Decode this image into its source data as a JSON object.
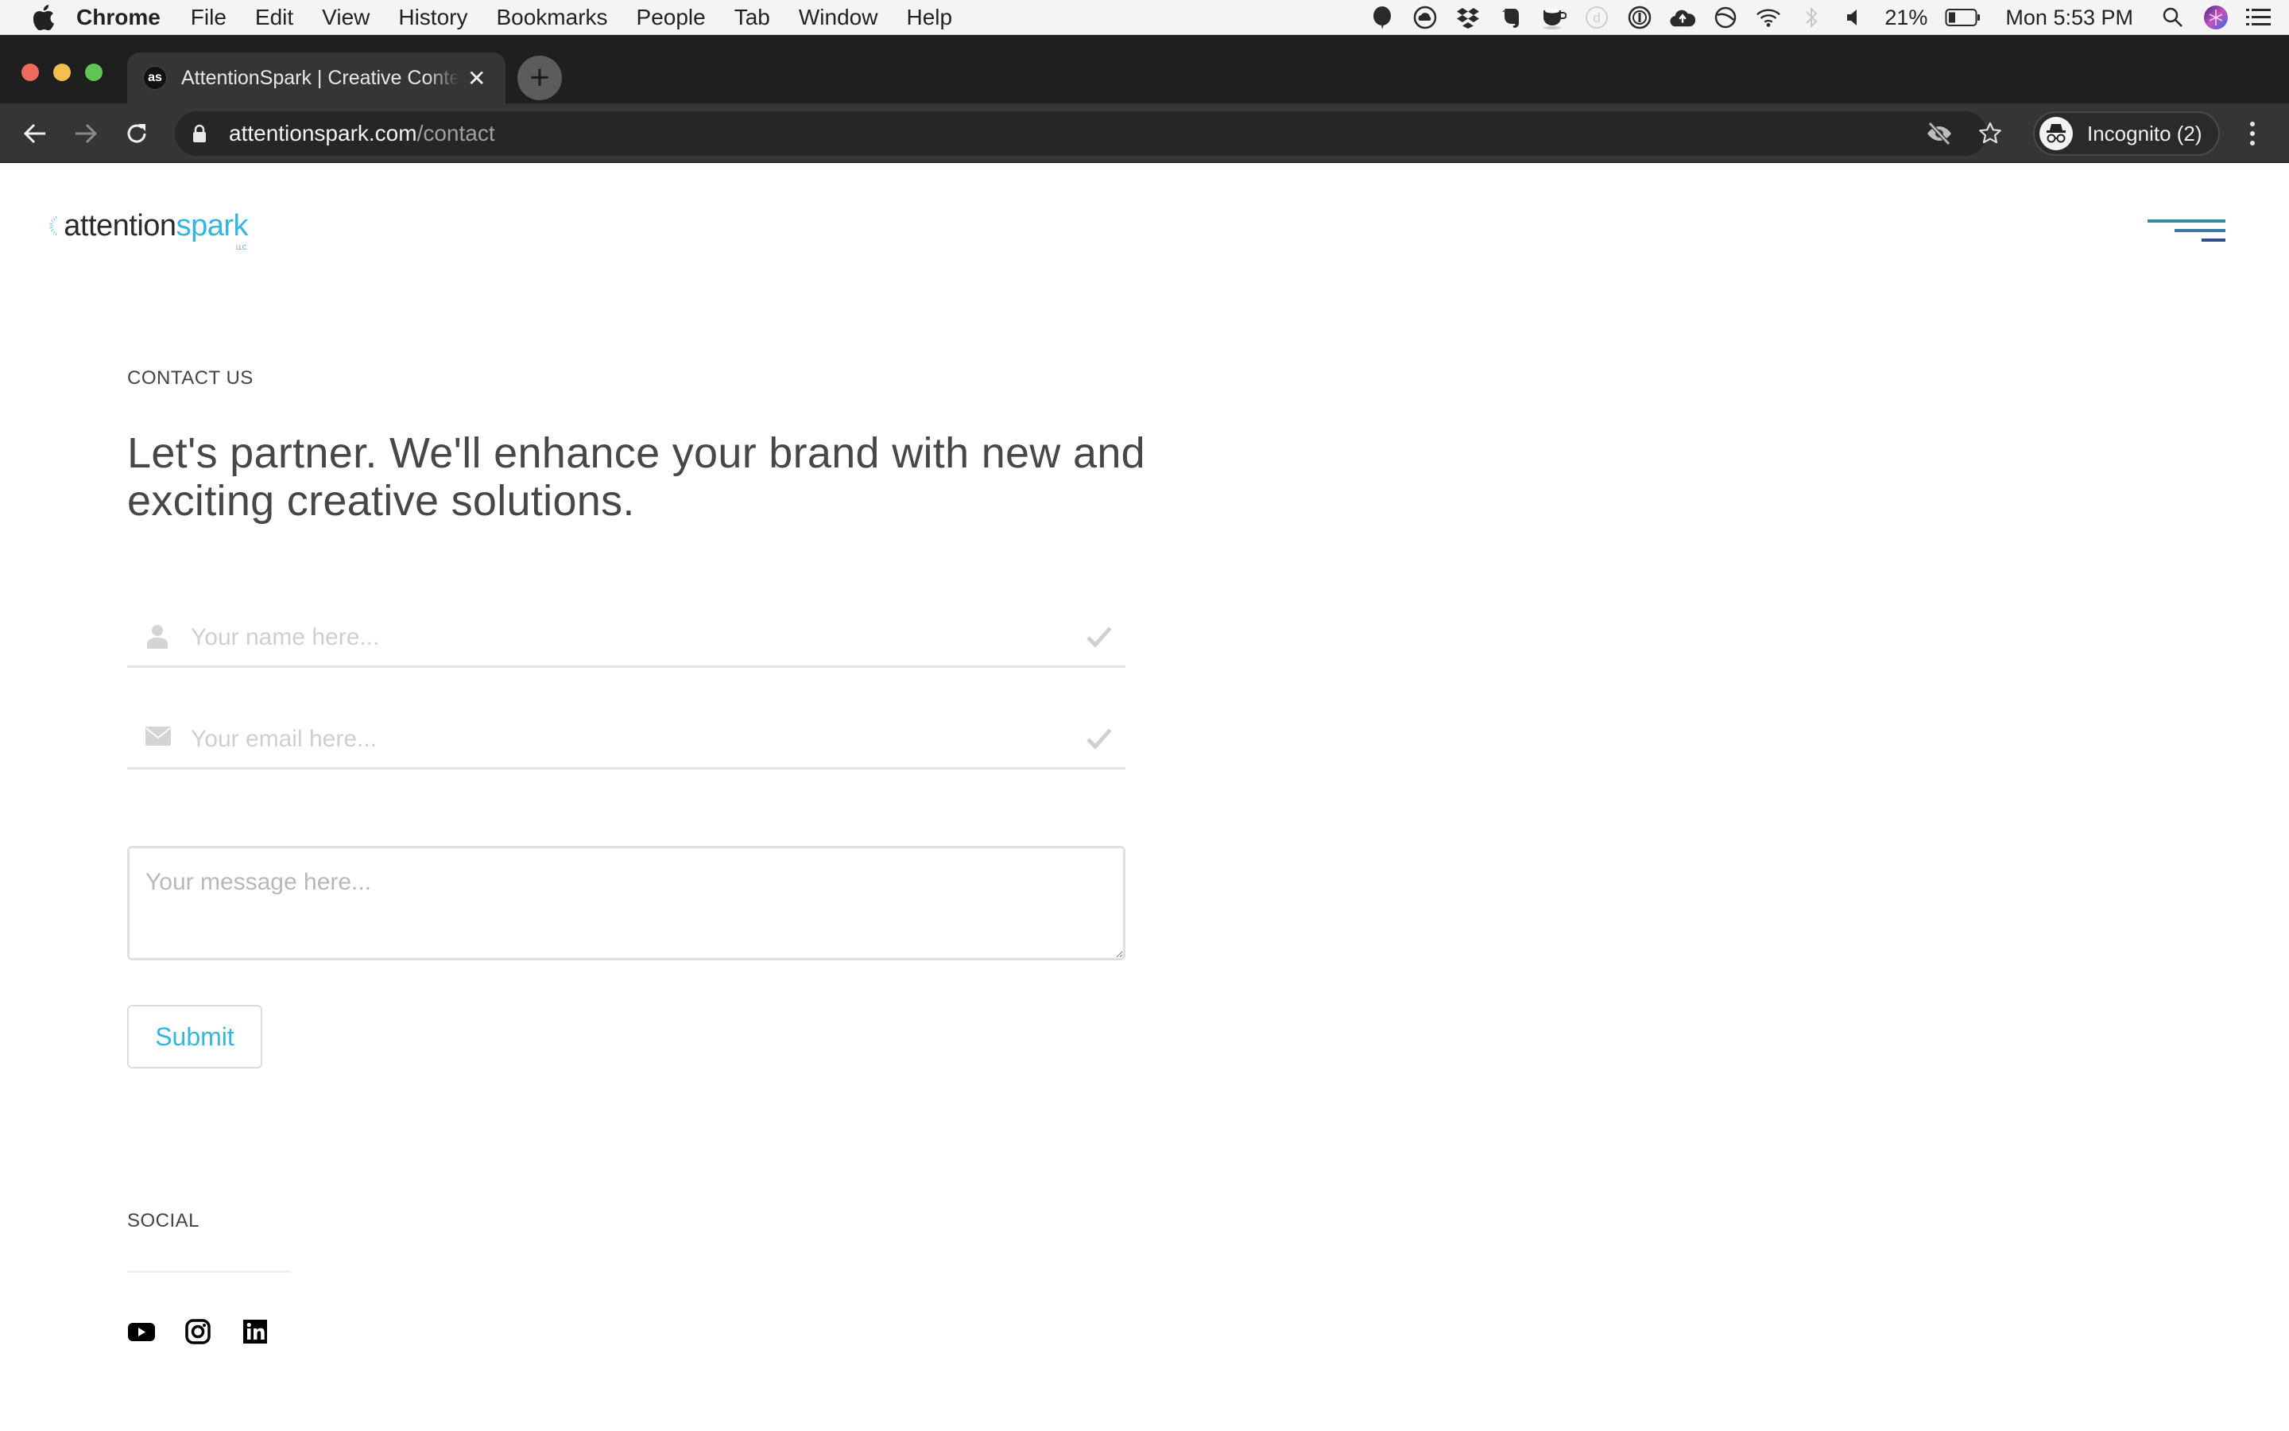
{
  "menubar": {
    "app_name": "Chrome",
    "items": [
      "File",
      "Edit",
      "View",
      "History",
      "Bookmarks",
      "People",
      "Tab",
      "Window",
      "Help"
    ],
    "battery_percent": "21%",
    "clock": "Mon 5:53 PM"
  },
  "browser": {
    "tab_title": "AttentionSpark | Creative Content",
    "tab_favicon_text": "as",
    "url_host": "attentionspark.com",
    "url_path": "/contact",
    "incognito_label": "Incognito (2)"
  },
  "site": {
    "logo_word_1": "attention",
    "logo_word_2": "spark",
    "logo_suffix": "LLC",
    "brand_color": "#35b6dc"
  },
  "contact": {
    "eyebrow": "CONTACT US",
    "headline": "Let's partner. We'll enhance your brand with new and exciting creative solutions.",
    "name_placeholder": "Your name here...",
    "name_value": "",
    "email_placeholder": "Your email here...",
    "email_value": "",
    "message_placeholder": "Your message here...",
    "message_value": "",
    "submit_label": "Submit"
  },
  "social": {
    "title": "SOCIAL",
    "links": [
      "youtube",
      "instagram",
      "linkedin"
    ]
  }
}
